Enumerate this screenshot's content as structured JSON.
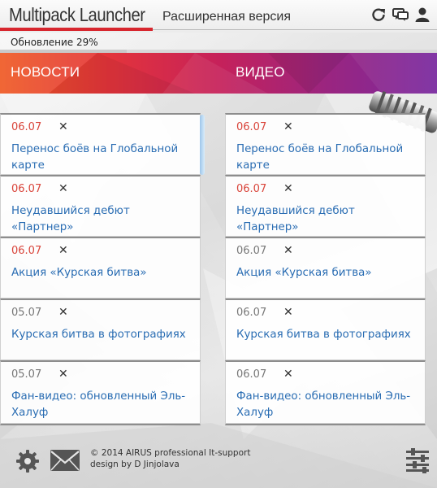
{
  "header": {
    "title": "Multipack Launcher",
    "subtitle": "Расширенная версия",
    "icons": [
      "refresh-icon",
      "chat-icon",
      "user-icon"
    ],
    "accent_color": "#d7262e"
  },
  "update": {
    "status": "Обновление 29%",
    "progress": 0.29
  },
  "tabs": [
    {
      "label": "НОВОСТИ"
    },
    {
      "label": "ВИДЕО"
    }
  ],
  "news": [
    {
      "date": "06.07",
      "is_new": true,
      "close": "✕",
      "title": "Перенос боёв на Глобальной карте"
    },
    {
      "date": "06.07",
      "is_new": true,
      "close": "✕",
      "title": "Неудавшийся дебют «Партнер»"
    },
    {
      "date": "06.07",
      "is_new": true,
      "close": "✕",
      "title": "Акция «Курская битва»"
    },
    {
      "date": "05.07",
      "is_new": false,
      "close": "✕",
      "title": "Курская битва в фотографиях"
    },
    {
      "date": "05.07",
      "is_new": false,
      "close": "✕",
      "title": "Фан-видео: обновленный Эль-Халуф"
    }
  ],
  "videos": [
    {
      "date": "06.07",
      "is_new": true,
      "close": "✕",
      "title": "Перенос боёв на Глобальной карте"
    },
    {
      "date": "06.07",
      "is_new": true,
      "close": "✕",
      "title": "Неудавшийся дебют «Партнер»"
    },
    {
      "date": "06.07",
      "is_new": false,
      "close": "✕",
      "title": "Акция «Курская битва»"
    },
    {
      "date": "06.07",
      "is_new": false,
      "close": "✕",
      "title": "Курская битва в фотографиях"
    },
    {
      "date": "06.07",
      "is_new": false,
      "close": "✕",
      "title": "Фан-видео: обновленный Эль-Халуф"
    }
  ],
  "footer": {
    "copyright_line1": "© 2014 AIRUS professional It-support",
    "copyright_line2": "design by D Jinjolava",
    "icons": [
      "gear-icon",
      "mail-icon",
      "equalizer-icon"
    ]
  },
  "colors": {
    "link": "#2a6db3",
    "date_new": "#d9443a",
    "date_old": "#777777",
    "banner_start": "#ef5a24",
    "banner_end": "#7a2aa0"
  }
}
